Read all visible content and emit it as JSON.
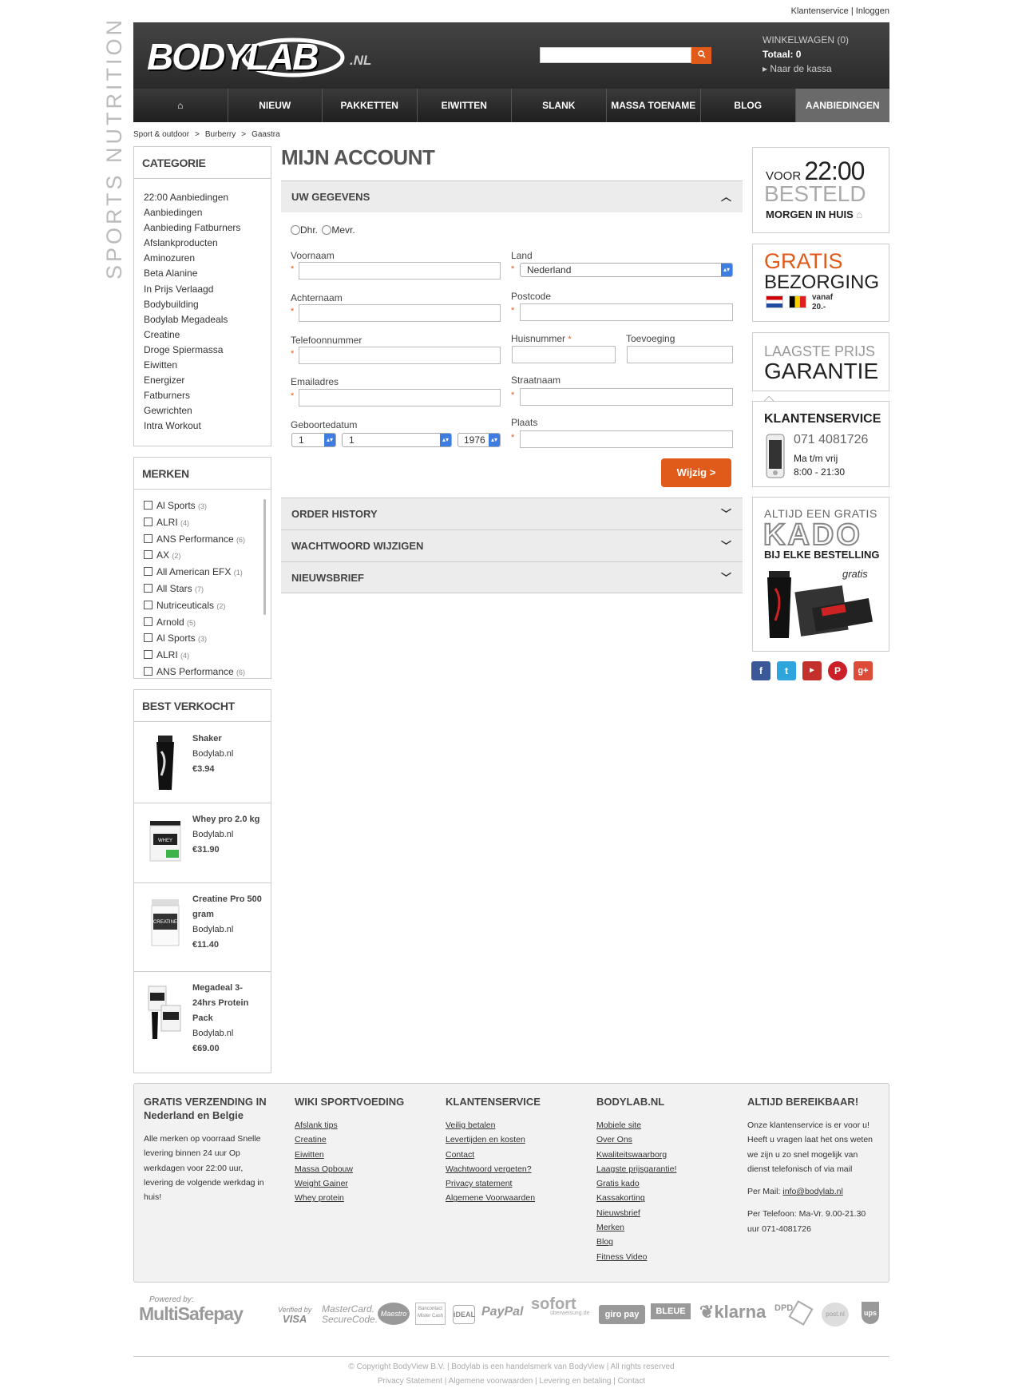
{
  "toplinks": {
    "service": "Klantenservice",
    "sep": "|",
    "login": "Inloggen"
  },
  "side_brand": "SPORTS NUTRITION",
  "logo": {
    "text": "BODYLAB",
    "tld": ".NL"
  },
  "search": {
    "placeholder": ""
  },
  "cart": {
    "title": "WINKELWAGEN (0)",
    "total": "Totaal: 0",
    "checkout": "Naar de kassa"
  },
  "nav": [
    "NIEUW",
    "PAKKETTEN",
    "EIWITTEN",
    "SLANK",
    "MASSA TOENAME",
    "BLOG",
    "AANBIEDINGEN"
  ],
  "breadcrumb": [
    "Sport & outdoor",
    "Burberry",
    "Gaastra"
  ],
  "categorie": {
    "title": "CATEGORIE",
    "items": [
      "22:00 Aanbiedingen",
      "Aanbiedingen",
      "Aanbieding Fatburners",
      "Afslankproducten",
      "Aminozuren",
      "Beta Alanine",
      "In Prijs Verlaagd",
      "Bodybuilding",
      "Bodylab Megadeals",
      "Creatine",
      "Droge Spiermassa",
      "Eiwitten",
      "Energizer",
      "Fatburners",
      "Gewrichten",
      "Intra Workout"
    ]
  },
  "merken": {
    "title": "MERKEN",
    "items": [
      {
        "name": "Al Sports",
        "count": "(3)"
      },
      {
        "name": "ALRI",
        "count": "(4)"
      },
      {
        "name": "ANS Performance",
        "count": "(6)"
      },
      {
        "name": "AX",
        "count": "(2)"
      },
      {
        "name": "All American EFX",
        "count": "(1)"
      },
      {
        "name": "All Stars",
        "count": "(7)"
      },
      {
        "name": "Nutriceuticals",
        "count": "(2)"
      },
      {
        "name": "Arnold",
        "count": "(5)"
      },
      {
        "name": "Al Sports",
        "count": "(3)"
      },
      {
        "name": "ALRI",
        "count": "(4)"
      },
      {
        "name": "ANS Performance",
        "count": "(6)"
      }
    ]
  },
  "best": {
    "title": "BEST VERKOCHT",
    "items": [
      {
        "name": "Shaker",
        "brand": "Bodylab.nl",
        "price": "€3.94"
      },
      {
        "name": "Whey pro 2.0 kg",
        "brand": "Bodylab.nl",
        "price": "€31.90"
      },
      {
        "name": "Creatine Pro 500 gram",
        "brand": "Bodylab.nl",
        "price": "€11.40"
      },
      {
        "name": "Megadeal 3-24hrs Protein Pack",
        "brand": "Bodylab.nl",
        "price": "€69.00"
      }
    ]
  },
  "account": {
    "title": "MIJN ACCOUNT",
    "section": "UW GEGEVENS",
    "salutation": [
      "Dhr.",
      "Mevr."
    ],
    "voornaam": "Voornaam",
    "achternaam": "Achternaam",
    "telefoon": "Telefoonnummer",
    "email": "Emailadres",
    "geboortedatum": "Geboortedatum",
    "dob_day": "1",
    "dob_month": "1",
    "dob_year": "1976",
    "land": "Land",
    "land_value": "Nederland",
    "postcode": "Postcode",
    "huisnummer": "Huisnummer",
    "toevoeging": "Toevoeging",
    "straatnaam": "Straatnaam",
    "plaats": "Plaats",
    "required": "*",
    "submit": "Wijzig >",
    "panels": [
      "ORDER HISTORY",
      "WACHTWOORD WIJZIGEN",
      "NIEUWSBRIEF"
    ]
  },
  "promo": {
    "voor": "VOOR",
    "time": "22:00",
    "besteld": "BESTELD",
    "morgen": "MORGEN IN HUIS",
    "gratis": "GRATIS",
    "bezorging": "BEZORGING",
    "vanaf": "vanaf",
    "vanaf_amount": "20.-",
    "laagste": "LAAGSTE PRIJS",
    "garantie": "GARANTIE",
    "ks_title": "KLANTENSERVICE",
    "ks_phone": "071 4081726",
    "ks_days": "Ma t/m vrij",
    "ks_hours": "8:00 - 21:30",
    "kado_top": "ALTIJD EEN GRATIS",
    "kado": "KADO",
    "kado_bottom": "BIJ ELKE BESTELLING",
    "kado_gratis": "gratis"
  },
  "social": [
    "facebook",
    "twitter",
    "youtube",
    "pinterest",
    "google-plus"
  ],
  "colors": {
    "accent": "#e05a1a",
    "dark": "#2a2a2a"
  },
  "footer": {
    "col1": {
      "title": "GRATIS VERZENDING IN Nederland en Belgie",
      "text": "Alle merken op voorraad Snelle levering binnen 24 uur Op werkdagen voor 22:00 uur, levering de volgende werkdag in huis!"
    },
    "col2": {
      "title": "WIKI SPORTVOEDING",
      "links": [
        "Afslank tips",
        "Creatine",
        "Eiwitten",
        "Massa Opbouw",
        "Weight Gainer",
        "Whey protein"
      ]
    },
    "col3": {
      "title": "KLANTENSERVICE",
      "links": [
        "Veilig betalen",
        "Levertijden en kosten",
        "Contact",
        "Wachtwoord vergeten?",
        "Privacy statement",
        "Algemene Voorwaarden"
      ]
    },
    "col4": {
      "title": "BODYLAB.NL",
      "links": [
        "Mobiele site",
        "Over Ons",
        "Kwaliteitswaarborg",
        "Laagste prijsgarantie!",
        "Gratis kado",
        "Kassakorting",
        "Nieuwsbrief",
        "Merken",
        "Blog",
        "Fitness Video"
      ]
    },
    "col5": {
      "title": "ALTIJD BEREIKBAAR!",
      "text": "Onze klantenservice is er voor u! Heeft u vragen laat het ons weten we zijn u zo snel mogelijk van dienst telefonisch of via mail",
      "mail_label": "Per Mail:",
      "mail": "info@bodylab.nl",
      "phone": "Per Telefoon: Ma-Vr. 9.00-21.30 uur 071-4081726"
    }
  },
  "payments": {
    "powered": "Powered by:",
    "multisafe": "MultiSafepay",
    "visa_top": "Verified by",
    "visa": "VISA",
    "mc": "MasterCard.",
    "mc2": "SecureCode.",
    "maestro": "Maestro",
    "bancontact": "Bancontact Mister Cash",
    "ideal": "iDEAL",
    "paypal": "PayPal",
    "sofort": "sofort",
    "sofort2": "überweisung.de",
    "giropay": "giro pay",
    "bleue": "BLEUE",
    "klarna": "klarna",
    "dpd": "DPD",
    "post": "post.nl",
    "ups": "ups"
  },
  "copyright": "© Copyright BodyView B.V. | Bodylab is een handelsmerk van BodyView | All rights reserved",
  "legal_links": [
    "Privacy Statement",
    "Algemene voorwaarden",
    "Levering en betaling",
    "Contact"
  ]
}
